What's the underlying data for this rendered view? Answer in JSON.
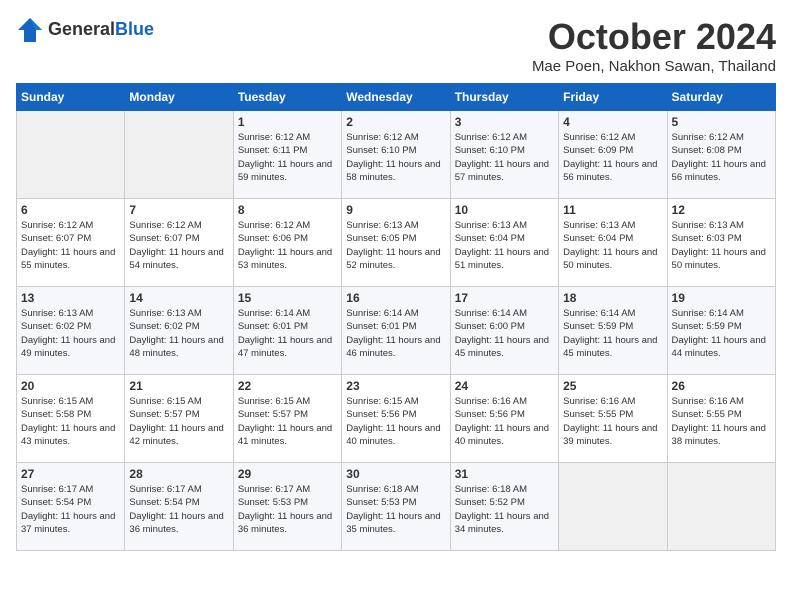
{
  "header": {
    "logo_general": "General",
    "logo_blue": "Blue",
    "month_title": "October 2024",
    "location": "Mae Poen, Nakhon Sawan, Thailand"
  },
  "weekdays": [
    "Sunday",
    "Monday",
    "Tuesday",
    "Wednesday",
    "Thursday",
    "Friday",
    "Saturday"
  ],
  "weeks": [
    [
      {
        "day": "",
        "info": ""
      },
      {
        "day": "",
        "info": ""
      },
      {
        "day": "1",
        "info": "Sunrise: 6:12 AM\nSunset: 6:11 PM\nDaylight: 11 hours and 59 minutes."
      },
      {
        "day": "2",
        "info": "Sunrise: 6:12 AM\nSunset: 6:10 PM\nDaylight: 11 hours and 58 minutes."
      },
      {
        "day": "3",
        "info": "Sunrise: 6:12 AM\nSunset: 6:10 PM\nDaylight: 11 hours and 57 minutes."
      },
      {
        "day": "4",
        "info": "Sunrise: 6:12 AM\nSunset: 6:09 PM\nDaylight: 11 hours and 56 minutes."
      },
      {
        "day": "5",
        "info": "Sunrise: 6:12 AM\nSunset: 6:08 PM\nDaylight: 11 hours and 56 minutes."
      }
    ],
    [
      {
        "day": "6",
        "info": "Sunrise: 6:12 AM\nSunset: 6:07 PM\nDaylight: 11 hours and 55 minutes."
      },
      {
        "day": "7",
        "info": "Sunrise: 6:12 AM\nSunset: 6:07 PM\nDaylight: 11 hours and 54 minutes."
      },
      {
        "day": "8",
        "info": "Sunrise: 6:12 AM\nSunset: 6:06 PM\nDaylight: 11 hours and 53 minutes."
      },
      {
        "day": "9",
        "info": "Sunrise: 6:13 AM\nSunset: 6:05 PM\nDaylight: 11 hours and 52 minutes."
      },
      {
        "day": "10",
        "info": "Sunrise: 6:13 AM\nSunset: 6:04 PM\nDaylight: 11 hours and 51 minutes."
      },
      {
        "day": "11",
        "info": "Sunrise: 6:13 AM\nSunset: 6:04 PM\nDaylight: 11 hours and 50 minutes."
      },
      {
        "day": "12",
        "info": "Sunrise: 6:13 AM\nSunset: 6:03 PM\nDaylight: 11 hours and 50 minutes."
      }
    ],
    [
      {
        "day": "13",
        "info": "Sunrise: 6:13 AM\nSunset: 6:02 PM\nDaylight: 11 hours and 49 minutes."
      },
      {
        "day": "14",
        "info": "Sunrise: 6:13 AM\nSunset: 6:02 PM\nDaylight: 11 hours and 48 minutes."
      },
      {
        "day": "15",
        "info": "Sunrise: 6:14 AM\nSunset: 6:01 PM\nDaylight: 11 hours and 47 minutes."
      },
      {
        "day": "16",
        "info": "Sunrise: 6:14 AM\nSunset: 6:01 PM\nDaylight: 11 hours and 46 minutes."
      },
      {
        "day": "17",
        "info": "Sunrise: 6:14 AM\nSunset: 6:00 PM\nDaylight: 11 hours and 45 minutes."
      },
      {
        "day": "18",
        "info": "Sunrise: 6:14 AM\nSunset: 5:59 PM\nDaylight: 11 hours and 45 minutes."
      },
      {
        "day": "19",
        "info": "Sunrise: 6:14 AM\nSunset: 5:59 PM\nDaylight: 11 hours and 44 minutes."
      }
    ],
    [
      {
        "day": "20",
        "info": "Sunrise: 6:15 AM\nSunset: 5:58 PM\nDaylight: 11 hours and 43 minutes."
      },
      {
        "day": "21",
        "info": "Sunrise: 6:15 AM\nSunset: 5:57 PM\nDaylight: 11 hours and 42 minutes."
      },
      {
        "day": "22",
        "info": "Sunrise: 6:15 AM\nSunset: 5:57 PM\nDaylight: 11 hours and 41 minutes."
      },
      {
        "day": "23",
        "info": "Sunrise: 6:15 AM\nSunset: 5:56 PM\nDaylight: 11 hours and 40 minutes."
      },
      {
        "day": "24",
        "info": "Sunrise: 6:16 AM\nSunset: 5:56 PM\nDaylight: 11 hours and 40 minutes."
      },
      {
        "day": "25",
        "info": "Sunrise: 6:16 AM\nSunset: 5:55 PM\nDaylight: 11 hours and 39 minutes."
      },
      {
        "day": "26",
        "info": "Sunrise: 6:16 AM\nSunset: 5:55 PM\nDaylight: 11 hours and 38 minutes."
      }
    ],
    [
      {
        "day": "27",
        "info": "Sunrise: 6:17 AM\nSunset: 5:54 PM\nDaylight: 11 hours and 37 minutes."
      },
      {
        "day": "28",
        "info": "Sunrise: 6:17 AM\nSunset: 5:54 PM\nDaylight: 11 hours and 36 minutes."
      },
      {
        "day": "29",
        "info": "Sunrise: 6:17 AM\nSunset: 5:53 PM\nDaylight: 11 hours and 36 minutes."
      },
      {
        "day": "30",
        "info": "Sunrise: 6:18 AM\nSunset: 5:53 PM\nDaylight: 11 hours and 35 minutes."
      },
      {
        "day": "31",
        "info": "Sunrise: 6:18 AM\nSunset: 5:52 PM\nDaylight: 11 hours and 34 minutes."
      },
      {
        "day": "",
        "info": ""
      },
      {
        "day": "",
        "info": ""
      }
    ]
  ]
}
